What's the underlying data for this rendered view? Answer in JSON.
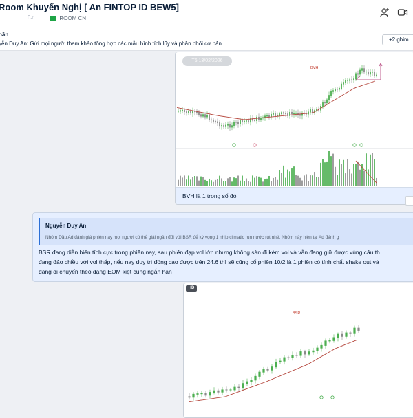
{
  "header": {
    "title": "Room Khuyến Nghị [ An FINTOP ID BEW5]",
    "subtitle_faint": "F..r",
    "tag_label": "ROOM CN",
    "icons": [
      "add-member-icon",
      "video-call-icon"
    ]
  },
  "pinned": {
    "sender": "hần",
    "text": "yễn Duy An: Gửi mọi người tham khảo tổng hợp các mẫu hình tích lũy và phân phối cơ bản",
    "button_label": "+2 ghim"
  },
  "message1": {
    "timestamp": "T6 13/02/2026",
    "chart_symbol": "BVH",
    "caption": "BVH là 1 trong số đó"
  },
  "message2": {
    "quote_sender": "Nguyễn Duy An",
    "quote_text": "Nhóm Dầu Ad đánh giá phiên nay mọi người có thể giải ngân đối với BSR để kỳ vọng 1 nhịp climatic run nước rút nhé. Nhóm này hiện tại Ad đánh g",
    "lines": [
      "BSR đang diễn biến tích cực trong phiên nay, sau phiên đạp vol lớn nhưng không sàn đi kèm vol và vẫn đang giữ được vùng câu th",
      "đang đảo chiều với vol thấp, nếu nay duy trì đóng cao được trên 24.6 thì sẽ cũng cố phiên 10/2 là 1 phiên có tính chất shake out và",
      "đang di chuyển theo dạng EOM kiệt cung ngắn hạn"
    ]
  },
  "message3": {
    "badge": "HD",
    "chart_symbol": "BSR"
  },
  "colors": {
    "accent": "#2b6fd6",
    "up_candle": "#4caf50",
    "down_candle": "#8a8a8a",
    "ma_line": "#b5473d",
    "volume_up": "#66bb6a",
    "volume_down": "#9e9e9e"
  }
}
